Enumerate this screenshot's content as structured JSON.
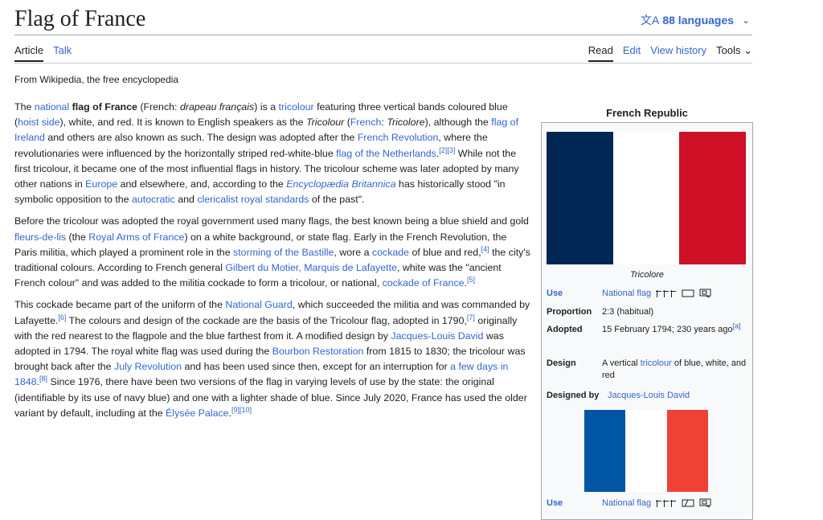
{
  "page": {
    "title": "Flag of France",
    "languages": "88 languages",
    "from": "From Wikipedia, the free encyclopedia"
  },
  "tabs": {
    "article": "Article",
    "talk": "Talk",
    "read": "Read",
    "edit": "Edit",
    "history": "View history",
    "tools": "Tools"
  },
  "infobox": {
    "caption": "French Republic",
    "flag_caption": "Tricolore",
    "colors": {
      "navy": "#002654",
      "white": "#ffffff",
      "red": "#ce1126",
      "blue": "#0055a4",
      "red2": "#ef4135"
    },
    "use_label": "Use",
    "use_value": "National flag",
    "proportion_label": "Proportion",
    "proportion_value": "2:3 (habitual)",
    "adopted_label": "Adopted",
    "adopted_value": "15 February 1794; 230 years ago",
    "adopted_ref": "[a]",
    "design_label": "Design",
    "design_pre": "A vertical ",
    "design_link": "tricolour",
    "design_post": " of blue, white, and red",
    "designed_label": "Designed by",
    "designed_value": "Jacques-Louis David",
    "use2_label": "Use",
    "use2_value": "National flag"
  },
  "p1": {
    "a": "The ",
    "l1": "national",
    "b": " ",
    "bold": "flag of France",
    "c": " (French: ",
    "i1": "drapeau français",
    "d": ") is a ",
    "l2": "tricolour",
    "e": " featuring three vertical bands coloured blue (",
    "l3": "hoist side",
    "f": "), white, and red. It is known to English speakers as the ",
    "i2": "Tricolour",
    "g": " (",
    "l4": "French",
    "h": ": ",
    "i3": "Tricolore",
    "j": "), although the ",
    "l5": "flag of Ireland",
    "k": " and others are also known as such. The design was adopted after the ",
    "l6": "French Revolution",
    "m": ", where the revolutionaries were influenced by the horizontally striped red-white-blue ",
    "l7": "flag of the Netherlands",
    "r1": "[2]",
    "r2": "[3]",
    "n": " While not the first tricolour, it became one of the most influential flags in history. The tricolour scheme was later adopted by many other nations in ",
    "l8": "Europe",
    "o": " and elsewhere, and, according to the ",
    "l9": "Encyclopædia Britannica",
    "q": " has historically stood \"in symbolic opposition to the ",
    "l10": "autocratic",
    "s": " and ",
    "l11": "clericalist royal standards",
    "t": " of the past\"."
  },
  "p2": {
    "a": "Before the tricolour was adopted the royal government used many flags, the best known being a blue shield and gold ",
    "l1": "fleurs-de-lis",
    "b": " (the ",
    "l2": "Royal Arms of France",
    "c": ") on a white background, or state flag. Early in the French Revolution, the Paris militia, which played a prominent role in the ",
    "l3": "storming of the Bastille",
    "d": ", wore a ",
    "l4": "cockade",
    "e": " of blue and red,",
    "r1": "[4]",
    "f": " the city's traditional colours. According to French general ",
    "l5": "Gilbert du Motier, Marquis de Lafayette",
    "g": ", white was the \"ancient French colour\" and was added to the militia cockade to form a tricolour, or national, ",
    "l6": "cockade of France",
    "h": ".",
    "r2": "[5]"
  },
  "p3": {
    "a": "This cockade became part of the uniform of the ",
    "l1": "National Guard",
    "b": ", which succeeded the militia and was commanded by Lafayette.",
    "r1": "[6]",
    "c": " The colours and design of the cockade are the basis of the Tricolour flag, adopted in 1790,",
    "r2": "[7]",
    "d": " originally with the red nearest to the flagpole and the blue farthest from it. A modified design by ",
    "l2": "Jacques-Louis David",
    "e": " was adopted in 1794. The royal white flag was used during the ",
    "l3": "Bourbon Restoration",
    "f": " from 1815 to 1830; the tricolour was brought back after the ",
    "l4": "July Revolution",
    "g": " and has been used since then, except for an interruption for ",
    "l5": "a few days in 1848",
    "h": ".",
    "r3": "[8]",
    "i": " Since 1976, there have been two versions of the flag in varying levels of use by the state: the original (identifiable by its use of navy blue) and one with a lighter shade of blue. Since July 2020, France has used the older variant by default, including at the ",
    "l6": "Élysée Palace",
    "j": ".",
    "r4": "[9]",
    "r5": "[10]"
  }
}
